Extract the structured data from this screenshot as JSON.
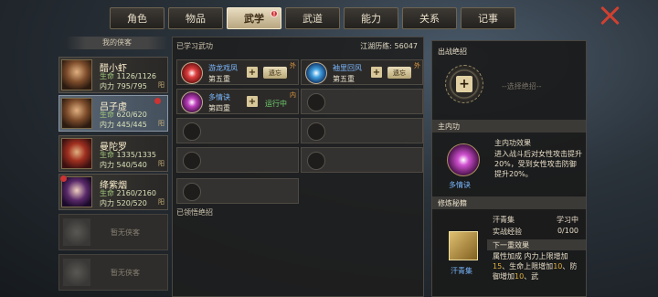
{
  "tabs": [
    {
      "label": "角色",
      "active": false
    },
    {
      "label": "物品",
      "active": false
    },
    {
      "label": "武学",
      "active": true,
      "badge": "!"
    },
    {
      "label": "武道",
      "active": false
    },
    {
      "label": "能力",
      "active": false
    },
    {
      "label": "关系",
      "active": false
    },
    {
      "label": "记事",
      "active": false
    }
  ],
  "close_icon": "close-x-icon",
  "left": {
    "header": "我的侠客",
    "characters": [
      {
        "name": "醋小虾",
        "hp_label": "生命",
        "hp": "1126/1126",
        "mp_label": "内力",
        "mp": "795/795",
        "tag": "阳"
      },
      {
        "name": "吕子虚",
        "hp_label": "生命",
        "hp": "620/620",
        "mp_label": "内力",
        "mp": "445/445",
        "tag": "阳",
        "active": true
      },
      {
        "name": "曼陀罗",
        "hp_label": "生命",
        "hp": "1335/1335",
        "mp_label": "内力",
        "mp": "540/540",
        "tag": "阳"
      },
      {
        "name": "绛紫烟",
        "hp_label": "生命",
        "hp": "2160/2160",
        "mp_label": "内力",
        "mp": "520/520",
        "tag": "阳"
      }
    ],
    "empty_label": "暂无侠客"
  },
  "middle": {
    "title": "已学习武功",
    "experience_label": "江湖历练:",
    "experience_value": "56047",
    "skills": [
      {
        "name": "游龙戏凤",
        "level": "第五重",
        "corner": "外",
        "action": "遗忘",
        "icon": "red"
      },
      {
        "name": "袖里回风",
        "level": "第五重",
        "corner": "外",
        "action": "遗忘",
        "icon": "blue"
      },
      {
        "name": "多情诀",
        "level": "第四重",
        "corner": "内",
        "status": "运行中",
        "icon": "purple"
      }
    ],
    "footer": "已领悟绝招"
  },
  "right": {
    "ultimate_title": "出战绝招",
    "ultimate_hint": "--选择绝招--",
    "neigong_title": "主内功",
    "neigong_name": "多情诀",
    "effect_title": "主内功效果",
    "effect_text": "进入战斗后对女性攻击提升20%，受到女性攻击防御提升20%。",
    "book_section": "修炼秘籍",
    "book_name": "汗青集",
    "book_status": "学习中",
    "book_exp_label": "实战经验",
    "book_exp_value": "0/100",
    "next_effect_label": "下一重效果",
    "attr_label": "属性加成",
    "attr_text_1": "内力上限增加",
    "attr_val_1": "15",
    "attr_text_2": "、生命上限增加",
    "attr_val_2": "10",
    "attr_text_3": "、防御增加",
    "attr_val_3": "10",
    "attr_text_4": "、武"
  }
}
